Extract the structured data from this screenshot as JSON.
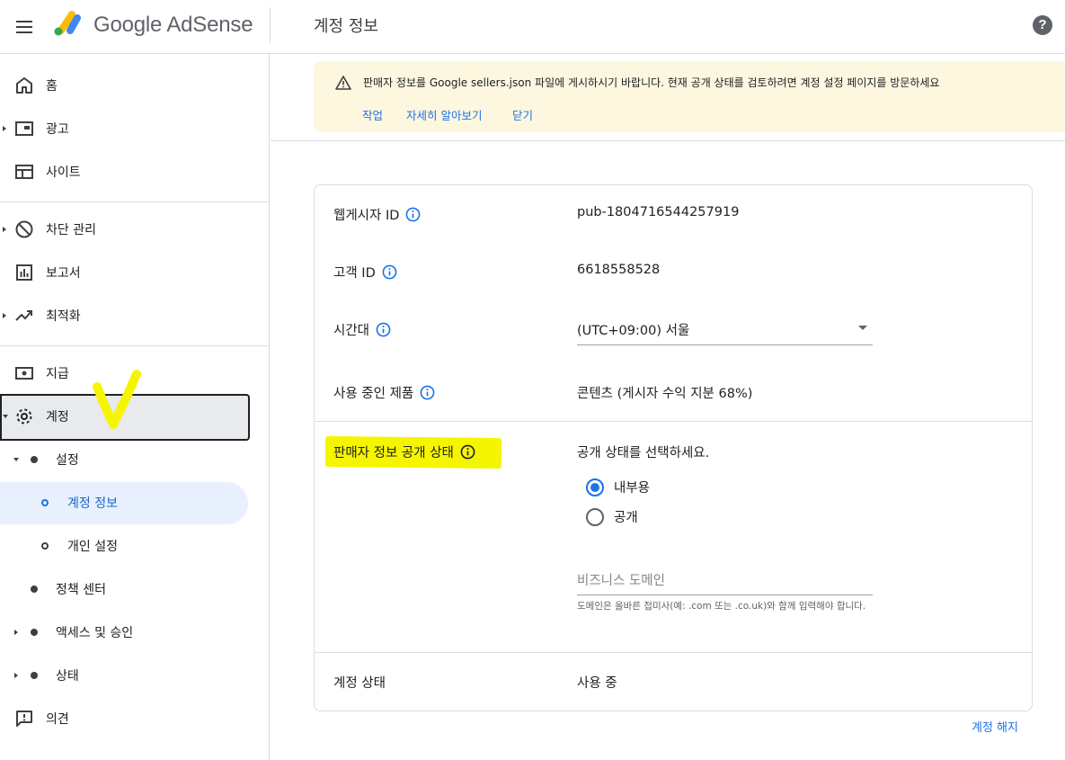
{
  "header": {
    "logo_text": "Google AdSense",
    "page_title": "계정 정보"
  },
  "sidebar": {
    "items": [
      {
        "label": "홈"
      },
      {
        "label": "광고"
      },
      {
        "label": "사이트"
      },
      {
        "label": "차단 관리"
      },
      {
        "label": "보고서"
      },
      {
        "label": "최적화"
      },
      {
        "label": "지급"
      },
      {
        "label": "계정"
      },
      {
        "label": "설정"
      },
      {
        "label": "계정 정보"
      },
      {
        "label": "개인 설정"
      },
      {
        "label": "정책 센터"
      },
      {
        "label": "액세스 및 승인"
      },
      {
        "label": "상태"
      },
      {
        "label": "의견"
      }
    ]
  },
  "banner": {
    "message": "판매자 정보를 Google sellers.json 파일에 게시하시기 바랍니다. 현재 공개 상태를 검토하려면 계정 설정 페이지를 방문하세요",
    "action_label": "작업",
    "learn_more_label": "자세히 알아보기",
    "close_label": "닫기"
  },
  "account": {
    "publisher_id_label": "웹게시자 ID",
    "publisher_id": "pub-1804716544257919",
    "customer_id_label": "고객 ID",
    "customer_id": "6618558528",
    "timezone_label": "시간대",
    "timezone_value": "(UTC+09:00) 서울",
    "products_label": "사용 중인 제품",
    "products_value": "콘텐츠 (게시자 수익 지분 68%)",
    "seller_visibility_label": "판매자 정보 공개 상태",
    "seller_visibility_prompt": "공개 상태를 선택하세요.",
    "visibility_options": [
      "내부용",
      "공개"
    ],
    "visibility_selected": "내부용",
    "business_domain_placeholder": "비즈니스 도메인",
    "business_domain_hint": "도메인은 올바른 접미사(예: .com 또는 .co.uk)와 함께 입력해야 합니다.",
    "status_label": "계정 상태",
    "status_value": "사용 중"
  },
  "footer": {
    "close_account_label": "계정 해지"
  },
  "colors": {
    "accent": "#1a73e8",
    "banner_bg": "#fef7e0",
    "highlight": "#f5f500"
  }
}
